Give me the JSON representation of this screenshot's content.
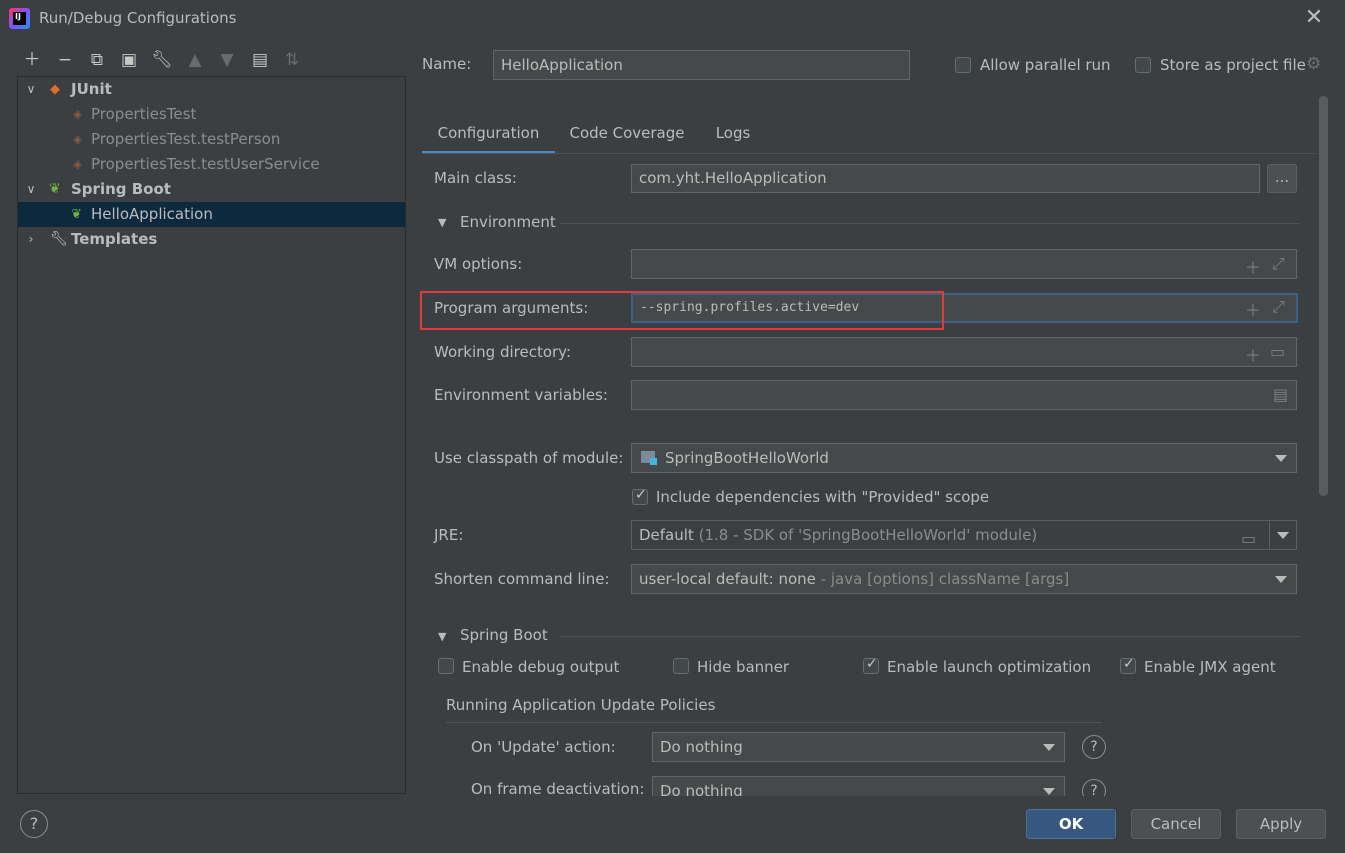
{
  "window": {
    "title": "Run/Debug Configurations"
  },
  "toolbar": {
    "icons": [
      "plus-icon",
      "minus-icon",
      "copy-icon",
      "save-icon",
      "wrench-icon",
      "arrow-up-icon",
      "arrow-down-icon",
      "folder-plus-icon",
      "sort-icon"
    ]
  },
  "tree": {
    "junit": "JUnit",
    "junit_items": [
      "PropertiesTest",
      "PropertiesTest.testPerson",
      "PropertiesTest.testUserService"
    ],
    "spring_boot": "Spring Boot",
    "spring_items": [
      "HelloApplication"
    ],
    "templates": "Templates"
  },
  "header": {
    "name_label": "Name:",
    "name_value": "HelloApplication",
    "allow_parallel": "Allow parallel run",
    "store_project": "Store as project file"
  },
  "tabs": [
    "Configuration",
    "Code Coverage",
    "Logs"
  ],
  "form": {
    "main_class_label": "Main class:",
    "main_class_value": "com.yht.HelloApplication",
    "browse": "...",
    "environment": "Environment",
    "vm_options": "VM options:",
    "program_args": "Program arguments:",
    "program_args_value": "--spring.profiles.active=dev",
    "working_dir": "Working directory:",
    "env_vars": "Environment variables:",
    "classpath_label": "Use classpath of module:",
    "classpath_value": "SpringBootHelloWorld",
    "include_deps": "Include dependencies with \"Provided\" scope",
    "jre_label": "JRE:",
    "jre_value": "Default",
    "jre_hint": "(1.8 - SDK of 'SpringBootHelloWorld' module)",
    "shorten_label": "Shorten command line:",
    "shorten_value": "user-local default: none",
    "shorten_hint": "- java [options] className [args]"
  },
  "spring_boot": {
    "section": "Spring Boot",
    "debug_output": "Enable debug output",
    "hide_banner": "Hide banner",
    "launch_opt": "Enable launch optimization",
    "jmx_agent": "Enable JMX agent",
    "policies": "Running Application Update Policies",
    "update_label": "On 'Update' action:",
    "update_value": "Do nothing",
    "frame_label": "On frame deactivation:",
    "frame_value": "Do nothing"
  },
  "buttons": {
    "ok": "OK",
    "cancel": "Cancel",
    "apply": "Apply",
    "help": "?"
  }
}
